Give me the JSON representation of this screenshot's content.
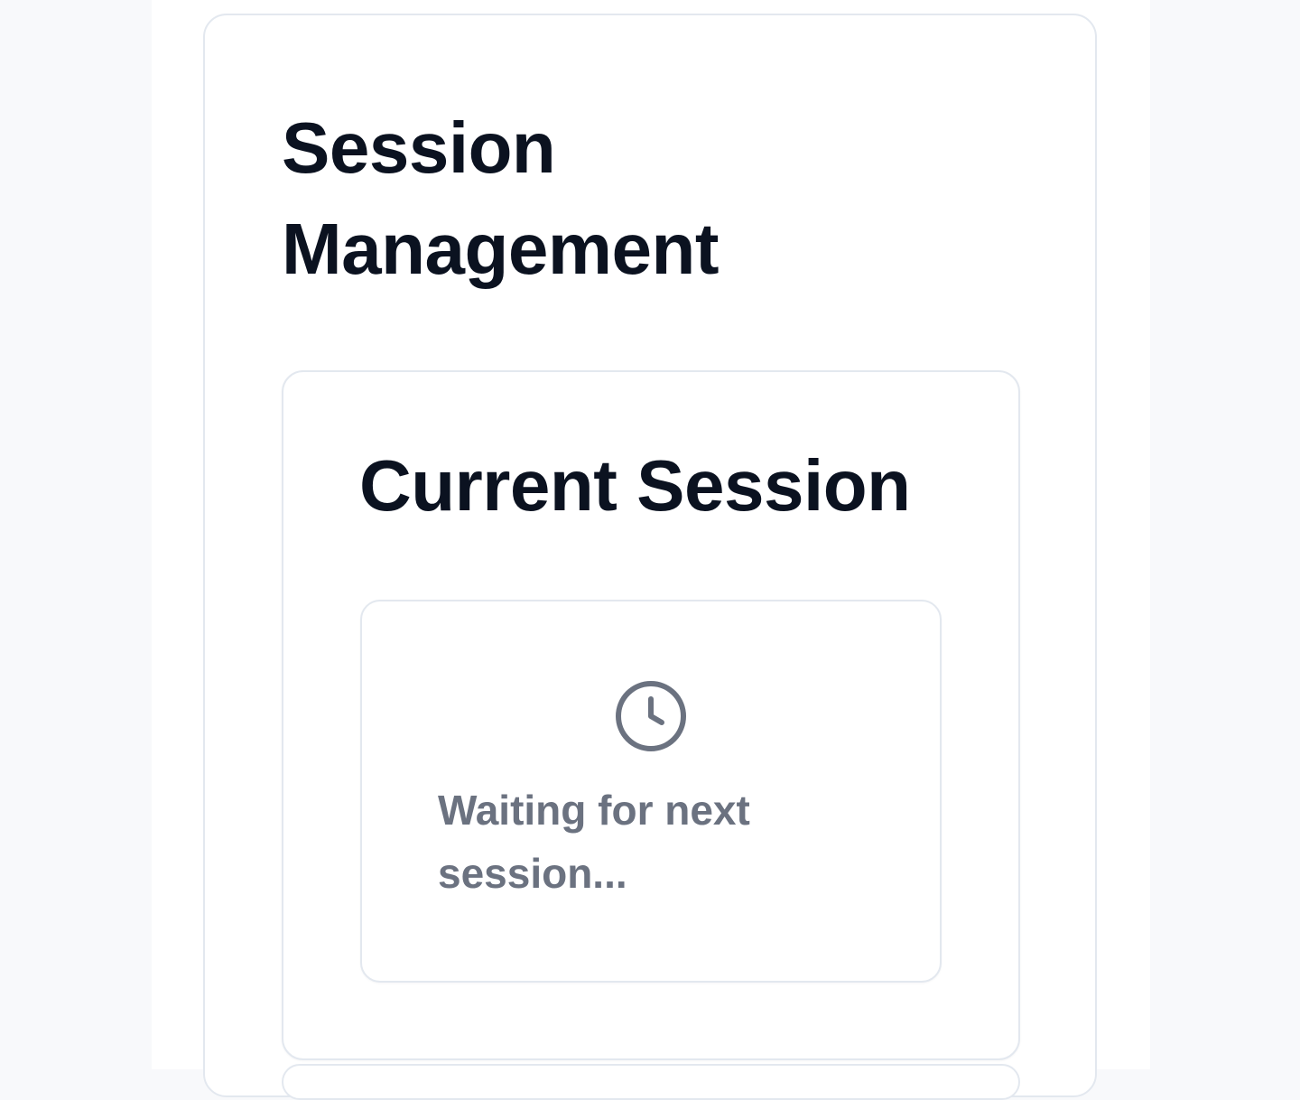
{
  "page": {
    "title": "Session Management"
  },
  "current_session": {
    "title": "Current Session",
    "status_icon": "clock-icon",
    "status_text": "Waiting for next session..."
  },
  "colors": {
    "background": "#f8f9fb",
    "card": "#ffffff",
    "border": "#e3e8ef",
    "heading": "#0b1220",
    "muted": "#6b7280"
  }
}
